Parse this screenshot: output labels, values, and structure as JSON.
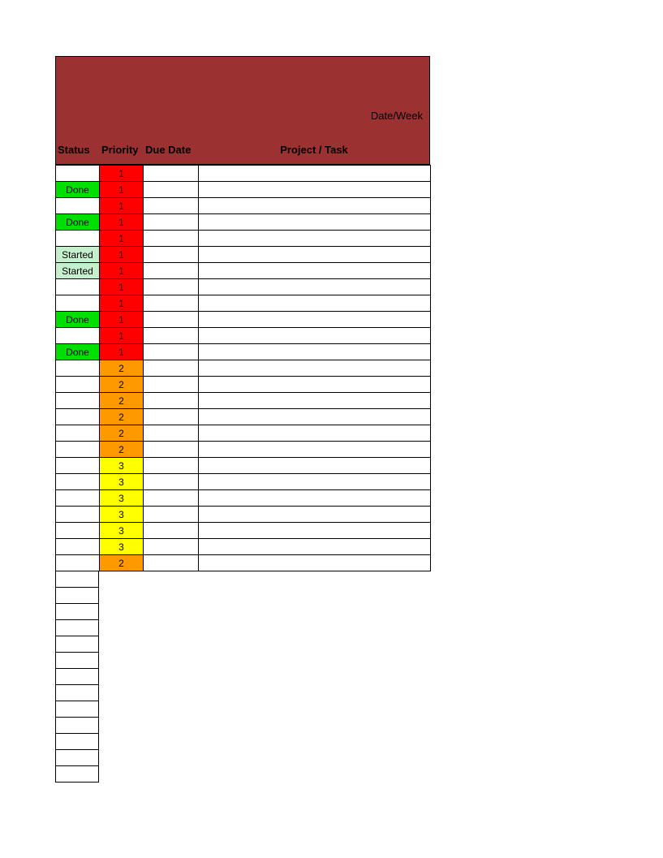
{
  "header": {
    "dateweek_label": "Date/Week",
    "columns": {
      "status": "Status",
      "priority": "Priority",
      "due_date": "Due Date",
      "project_task": "Project / Task"
    }
  },
  "colors": {
    "header_bg": "#9b3131",
    "status_done": "#00e000",
    "status_started": "#c6efce",
    "priority_1": "#ff0000",
    "priority_2": "#ff9900",
    "priority_3": "#ffff00"
  },
  "rows": [
    {
      "status": "",
      "priority": "1",
      "due_date": "",
      "project_task": ""
    },
    {
      "status": "Done",
      "priority": "1",
      "due_date": "",
      "project_task": ""
    },
    {
      "status": "",
      "priority": "1",
      "due_date": "",
      "project_task": ""
    },
    {
      "status": "Done",
      "priority": "1",
      "due_date": "",
      "project_task": ""
    },
    {
      "status": "",
      "priority": "1",
      "due_date": "",
      "project_task": ""
    },
    {
      "status": "Started",
      "priority": "1",
      "due_date": "",
      "project_task": ""
    },
    {
      "status": "Started",
      "priority": "1",
      "due_date": "",
      "project_task": ""
    },
    {
      "status": "",
      "priority": "1",
      "due_date": "",
      "project_task": ""
    },
    {
      "status": "",
      "priority": "1",
      "due_date": "",
      "project_task": ""
    },
    {
      "status": "Done",
      "priority": "1",
      "due_date": "",
      "project_task": ""
    },
    {
      "status": "",
      "priority": "1",
      "due_date": "",
      "project_task": ""
    },
    {
      "status": "Done",
      "priority": "1",
      "due_date": "",
      "project_task": ""
    },
    {
      "status": "",
      "priority": "2",
      "due_date": "",
      "project_task": ""
    },
    {
      "status": "",
      "priority": "2",
      "due_date": "",
      "project_task": ""
    },
    {
      "status": "",
      "priority": "2",
      "due_date": "",
      "project_task": ""
    },
    {
      "status": "",
      "priority": "2",
      "due_date": "",
      "project_task": ""
    },
    {
      "status": "",
      "priority": "2",
      "due_date": "",
      "project_task": ""
    },
    {
      "status": "",
      "priority": "2",
      "due_date": "",
      "project_task": ""
    },
    {
      "status": "",
      "priority": "3",
      "due_date": "",
      "project_task": ""
    },
    {
      "status": "",
      "priority": "3",
      "due_date": "",
      "project_task": ""
    },
    {
      "status": "",
      "priority": "3",
      "due_date": "",
      "project_task": ""
    },
    {
      "status": "",
      "priority": "3",
      "due_date": "",
      "project_task": ""
    },
    {
      "status": "",
      "priority": "3",
      "due_date": "",
      "project_task": ""
    },
    {
      "status": "",
      "priority": "3",
      "due_date": "",
      "project_task": ""
    },
    {
      "status": "",
      "priority": "2",
      "due_date": "",
      "project_task": ""
    }
  ],
  "tail_empty_rows": 13
}
